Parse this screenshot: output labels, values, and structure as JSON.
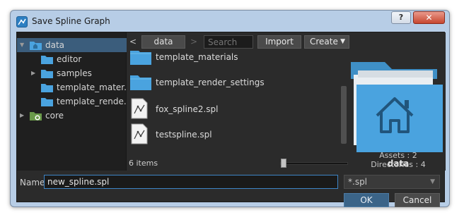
{
  "window": {
    "title": "Save Spline Graph",
    "help_label": "?",
    "close_label": "✕"
  },
  "tree": {
    "items": [
      {
        "label": "data",
        "expanded": true,
        "icon": "folder-icon"
      },
      {
        "label": "editor",
        "icon": "folder-icon"
      },
      {
        "label": "samples",
        "icon": "folder-icon"
      },
      {
        "label": "template_mater...",
        "icon": "folder-icon"
      },
      {
        "label": "template_rende...",
        "icon": "folder-icon"
      },
      {
        "label": "core",
        "icon": "core-folder-icon"
      }
    ]
  },
  "toolbar": {
    "back": "<",
    "breadcrumb": "data",
    "forward": ">",
    "search_placeholder": "Search",
    "import_label": "Import",
    "create_label": "Create"
  },
  "files": [
    {
      "label": "template_materials",
      "icon": "folder-icon"
    },
    {
      "label": "template_render_settings",
      "icon": "folder-icon"
    },
    {
      "label": "fox_spline2.spl",
      "icon": "spline-file-icon"
    },
    {
      "label": "testspline.spl",
      "icon": "spline-file-icon"
    }
  ],
  "status": {
    "count": "6 items",
    "zoom_fraction": 0.05
  },
  "preview": {
    "name": "data",
    "assets": "Assets : 2",
    "directories": "Directories : 4"
  },
  "name_row": {
    "label": "Name",
    "value": "new_spline.spl",
    "filter": "*.spl"
  },
  "buttons": {
    "ok": "OK",
    "cancel": "Cancel"
  },
  "colors": {
    "accent": "#3b5d7c",
    "folder": "#4aa3df",
    "ok_button": "#3b6488"
  }
}
